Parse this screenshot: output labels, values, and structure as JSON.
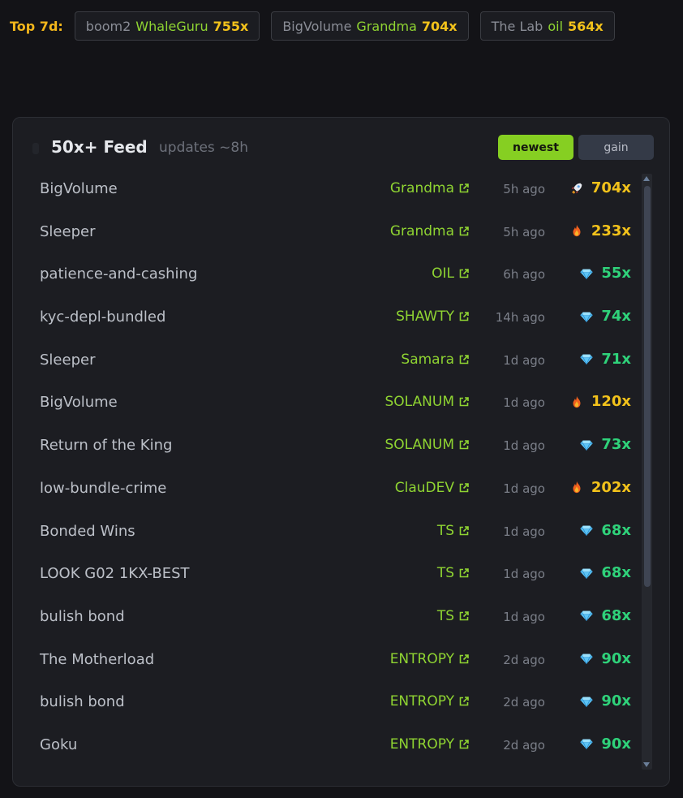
{
  "top": {
    "label": "Top 7d:",
    "items": [
      {
        "channel": "boom2",
        "caller": "WhaleGuru",
        "multiple": "755x"
      },
      {
        "channel": "BigVolume",
        "caller": "Grandma",
        "multiple": "704x"
      },
      {
        "channel": "The Lab",
        "caller": "oil",
        "multiple": "564x"
      }
    ]
  },
  "feed": {
    "title": "50x+ Feed",
    "subtitle": "updates ~8h",
    "sort_newest": "newest",
    "sort_gain": "gain",
    "rows": [
      {
        "name": "BigVolume",
        "caller": "Grandma",
        "ago": "5h ago",
        "icon": "rocket-icon",
        "gain": "704x",
        "tone": "hot"
      },
      {
        "name": "Sleeper",
        "caller": "Grandma",
        "ago": "5h ago",
        "icon": "fire-icon",
        "gain": "233x",
        "tone": "hot"
      },
      {
        "name": "patience-and-cashing",
        "caller": "OIL",
        "ago": "6h ago",
        "icon": "diamond-icon",
        "gain": "55x",
        "tone": "ok"
      },
      {
        "name": "kyc-depl-bundled",
        "caller": "SHAWTY",
        "ago": "14h ago",
        "icon": "diamond-icon",
        "gain": "74x",
        "tone": "ok"
      },
      {
        "name": "Sleeper",
        "caller": "Samara",
        "ago": "1d ago",
        "icon": "diamond-icon",
        "gain": "71x",
        "tone": "ok"
      },
      {
        "name": "BigVolume",
        "caller": "SOLANUM",
        "ago": "1d ago",
        "icon": "fire-icon",
        "gain": "120x",
        "tone": "hot"
      },
      {
        "name": "Return of the King",
        "caller": "SOLANUM",
        "ago": "1d ago",
        "icon": "diamond-icon",
        "gain": "73x",
        "tone": "ok"
      },
      {
        "name": "low-bundle-crime",
        "caller": "ClauDEV",
        "ago": "1d ago",
        "icon": "fire-icon",
        "gain": "202x",
        "tone": "hot"
      },
      {
        "name": "Bonded Wins",
        "caller": "TS",
        "ago": "1d ago",
        "icon": "diamond-icon",
        "gain": "68x",
        "tone": "ok"
      },
      {
        "name": "LOOK G02 1KX-BEST",
        "caller": "TS",
        "ago": "1d ago",
        "icon": "diamond-icon",
        "gain": "68x",
        "tone": "ok"
      },
      {
        "name": "bulish bond",
        "caller": "TS",
        "ago": "1d ago",
        "icon": "diamond-icon",
        "gain": "68x",
        "tone": "ok"
      },
      {
        "name": "The Motherload",
        "caller": "ENTROPY",
        "ago": "2d ago",
        "icon": "diamond-icon",
        "gain": "90x",
        "tone": "ok"
      },
      {
        "name": "bulish bond",
        "caller": "ENTROPY",
        "ago": "2d ago",
        "icon": "diamond-icon",
        "gain": "90x",
        "tone": "ok"
      },
      {
        "name": "Goku",
        "caller": "ENTROPY",
        "ago": "2d ago",
        "icon": "diamond-icon",
        "gain": "90x",
        "tone": "ok"
      }
    ]
  },
  "colors": {
    "accent_green": "#86cf22",
    "caller_green": "#8fd432",
    "gain_yellow": "#f2c21b",
    "gain_green": "#2fd27a"
  }
}
